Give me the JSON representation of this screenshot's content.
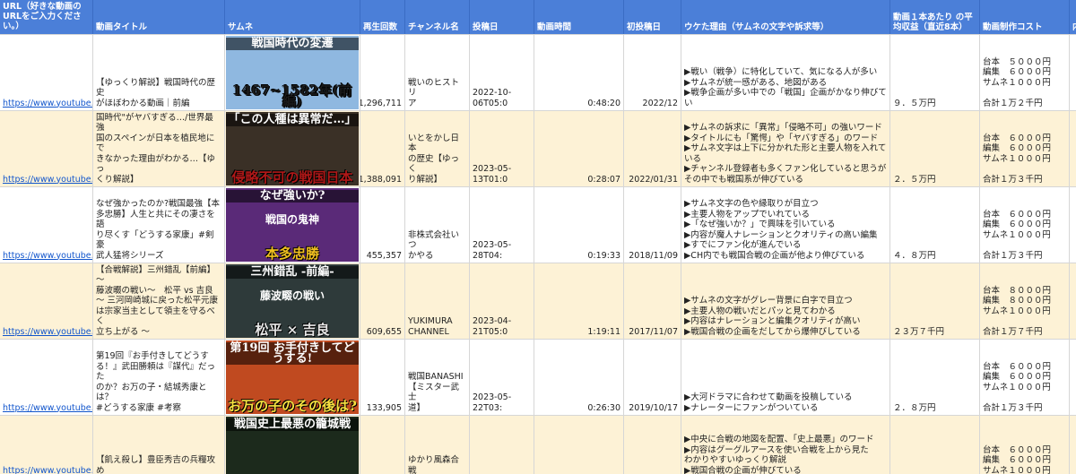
{
  "headers": {
    "url": "URL（好きな動画の\nURLをご入力くださ\nい。）",
    "title": "動画タイトル",
    "thumb": "サムネ",
    "views": "再生回数",
    "channel": "チャンネル名",
    "posted": "投稿日",
    "duration": "動画時間",
    "first_post": "初投稿日",
    "reason": "ウケた理由（サムネの文字や訴求等）",
    "revenue": "動画１本あたり\nの平均収益（直近8本）",
    "cost": "動画制作コスト",
    "extra": "内"
  },
  "rows": [
    {
      "url": "https://www.youtube.com",
      "title": "【ゆっくり解説】戦国時代の歴史\nがほぼわかる動画｜前編",
      "views": "1,296,711",
      "channel": "戦いのヒストリ\nア",
      "posted": "2022-10-06T05:0",
      "duration": "0:48:20",
      "first_post": "2022/12",
      "reason": "▶戦い（戦争）に特化していて、気になる人が多い\n▶サムネが統一感がある、地図がある\n▶戦争企画が多い中での「戦国」企画がかなり伸びてい",
      "revenue": "９．５万円",
      "cost": "台本　５０００円\n編集　６０００円\nサムネ１０００円\n\n合計１万２千円",
      "thumb": {
        "banner": "戦国時代の変遷",
        "caption": "1467~1582年(前編)",
        "bg": "#8fb8e0",
        "accent": "#1a1a1a"
      }
    },
    {
      "url": "https://www.youtube.com",
      "title": "【驚愕!!】世界が恐れた\"日本の戦\n国時代\"がヤバすぎる…/世界最強\n国のスペインが日本を植民地にで\nきなかった理由がわかる…【ゆっ\nくり解説】",
      "views": "1,388,091",
      "channel": "いとをかし日本\nの歴史【ゆっく\nり解説】",
      "posted": "2023-05-13T01:0",
      "duration": "0:28:07",
      "first_post": "2022/01/31",
      "reason": "▶サムネの訴求に「異常」「侵略不可」の強いワード\n▶タイトルにも「驚愕」や「ヤバすぎる」のワード\n▶サムネ文字は上下に分かれた形と主要人物を入れて\nいる\n▶チャンネル登録者も多くファン化していると思うが\nその中でも戦国系が伸びている",
      "revenue": "２．５万円",
      "cost": "台本　６０００円\n編集　６０００円\nサムネ１０００円\n\n合計１万３千円",
      "thumb": {
        "banner": "「この人種は異常だ…」",
        "caption": "侵略不可の戦国日本",
        "bg": "#3a3026",
        "accent": "#b01818"
      }
    },
    {
      "url": "https://www.youtube.com",
      "title": "なぜ強かったのか?戦国最強【本\n多忠勝】人生と共にその凄さを語\nり尽くす「どうする家康」#剣豪\n武人猛将シリーズ",
      "views": "455,357",
      "channel": "非株式会社いつ\nかやる",
      "posted": "2023-05-28T04:",
      "duration": "0:19:33",
      "first_post": "2018/11/09",
      "reason": "▶サムネ文字の色や縁取りが目立つ\n▶主要人物をアップでいれている\n▶「なぜ強いか？」で興味を引いている\n▶内容が魔人ナレーションとクオリティの高い編集\n▶すでにファン化が進んでいる\n▶CH内でも戦国合戦の企画が他より伸びている",
      "revenue": "４．８万円",
      "cost": "台本　６０００円\n編集　６０００円\nサムネ１０００円\n\n合計１万３千円",
      "thumb": {
        "banner": "なぜ強いか?",
        "caption": "本多忠勝",
        "sub": "戦国の鬼神",
        "bg": "#5a2a78",
        "accent": "#f0c020"
      }
    },
    {
      "url": "https://www.youtube.com",
      "title": "【合戦解説】三州錯乱【前編】 ～\n藤波畷の戦い～　松平 vs 吉良\n～ 三河岡崎城に戻った松平元康\nは宗家当主として領主を守るべく\n立ち上がる ～",
      "views": "609,655",
      "channel": "YUKIMURA\nCHANNEL",
      "posted": "2023-04-21T05:0",
      "duration": "1:19:11",
      "first_post": "2017/11/07",
      "reason": "▶サムネの文字がグレー背景に白字で目立つ\n▶主要人物の戦いだとパッと見てわかる\n▶内容はナレーションと編集クオリティが高い\n▶戦国合戦の企画をだしてから爆伸びしている",
      "revenue": "２３万７千円",
      "cost": "台本　８０００円\n編集　８０００円\nサムネ１０００円\n\n合計１万７千円",
      "thumb": {
        "banner": "三州錯乱 -前編-",
        "caption": "松平 × 吉良",
        "sub": "藤波畷の戦い",
        "bg": "#2e3a3a",
        "accent": "#e8e8e8"
      }
    },
    {
      "url": "https://www.youtube.com",
      "title": "第19回『お手付きしてどうす\nる！』武田勝頼は『謀代』だった\nのか？お万の子・結城秀康とは？\n#どうする家康 #考察",
      "views": "133,905",
      "channel": "戦国BANASHI\n【ミスター武士\n道】",
      "posted": "2023-05-22T03:",
      "duration": "0:26:30",
      "first_post": "2019/10/17",
      "reason": "▶大河ドラマに合わせて動画を投稿している\n▶ナレーターにファンがついている",
      "revenue": "２．８万円",
      "cost": "台本　６０００円\n編集　６０００円\nサムネ１０００円\n\n合計１万３千円",
      "thumb": {
        "banner": "第19回 お手付きしてどうする!",
        "caption": "お万の子のその後は?",
        "bg": "#c04a20",
        "accent": "#f7e040"
      }
    },
    {
      "url": "https://www.youtube.com",
      "title": "【飢え殺し】豊臣秀吉の兵糧攻め",
      "views": "",
      "channel": "ゆかり風森合戦",
      "posted": "",
      "duration": "",
      "first_post": "",
      "reason": "▶中央に合戦の地図を配置、「史上最悪」のワード\n▶内容はグーグルアースを使い合戦を上から見た\nわかりやすいゆっくり解説\n▶戦国合戦の企画が伸びている",
      "revenue": "",
      "cost": "台本　６０００円\n編集　６０００円\nサムネ１０００円",
      "thumb": {
        "banner": "戦国史上最悪の籠城戦",
        "caption": "",
        "bg": "#1c2a1c",
        "accent": "#ffffff"
      }
    }
  ]
}
